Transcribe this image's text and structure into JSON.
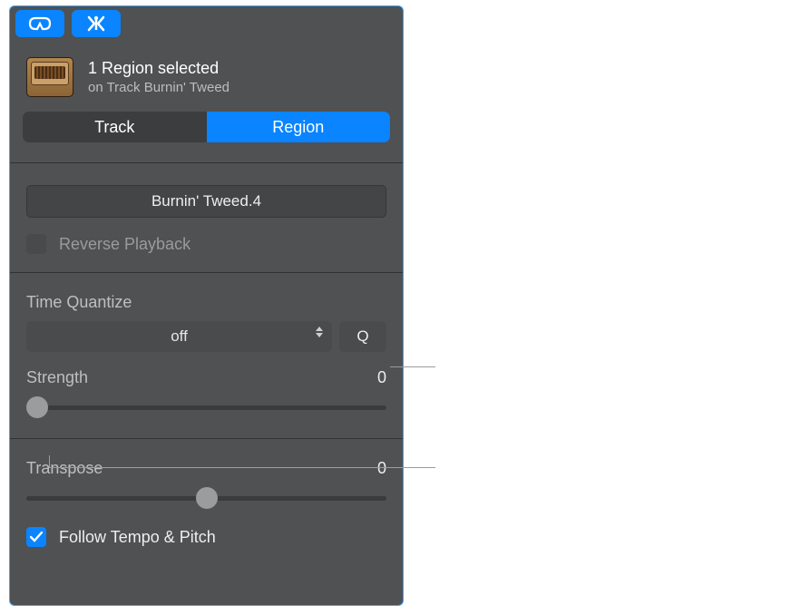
{
  "header": {
    "title": "1 Region selected",
    "subtitle": "on Track Burnin' Tweed"
  },
  "tabs": {
    "track": "Track",
    "region": "Region",
    "active": "region"
  },
  "region_name": "Burnin' Tweed.4",
  "reverse": {
    "label": "Reverse Playback",
    "checked": false
  },
  "time_quantize": {
    "label": "Time Quantize",
    "value": "off",
    "q_label": "Q",
    "strength_label": "Strength",
    "strength_value": "0",
    "strength_pos": 0
  },
  "transpose": {
    "label": "Transpose",
    "value": "0",
    "pos": 50
  },
  "follow": {
    "label": "Follow Tempo & Pitch",
    "checked": true
  }
}
